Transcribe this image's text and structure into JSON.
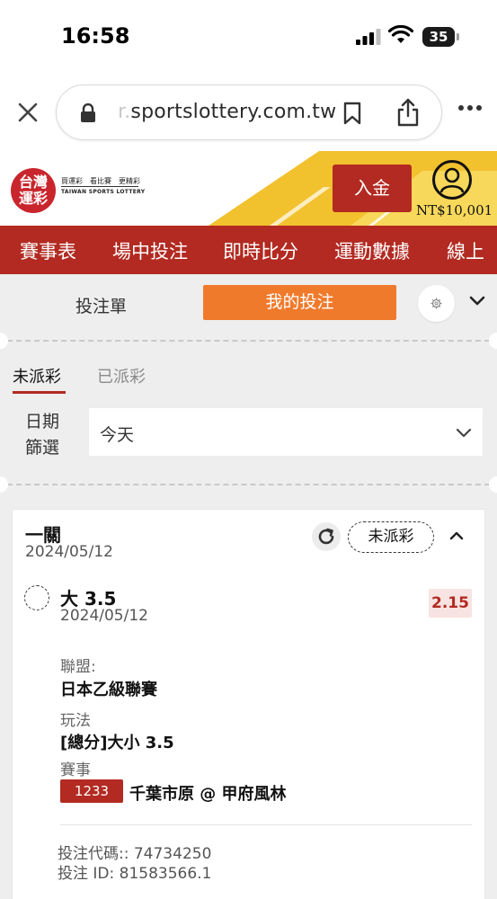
{
  "status_bar": {
    "time": "16:58",
    "battery": "35"
  },
  "browser": {
    "url_prefix": "r.",
    "url_main": "sportslottery.com.tw"
  },
  "header": {
    "logo_mark": "台灣運彩",
    "logo_slogans": "買運彩　看比賽　更精彩",
    "logo_english": "TAIWAN SPORTS LOTTERY",
    "deposit_label": "入金",
    "balance": "NT$10,001",
    "accent_color": "#b22a21",
    "highlight_color": "#f2c12e"
  },
  "nav": {
    "items": [
      "賽事表",
      "場中投注",
      "即時比分",
      "運動數據",
      "線上"
    ]
  },
  "panel": {
    "tabs": {
      "betslip": "投注單",
      "my_bets": "我的投注"
    },
    "subtabs": {
      "unsettled": "未派彩",
      "settled": "已派彩"
    },
    "date_filter": {
      "label_line1": "日期",
      "label_line2": "篩選",
      "value": "今天"
    }
  },
  "bet": {
    "type": "一關",
    "date": "2024/05/12",
    "status": "未派彩",
    "selection": {
      "name": "大 3.5",
      "date": "2024/05/12",
      "odds": "2.15"
    },
    "league_label": "聯盟:",
    "league": "日本乙級聯賽",
    "market_label": "玩法",
    "market": "[總分]大小 3.5",
    "event_label": "賽事",
    "event_id": "1233",
    "event_name": "千葉市原 @ 甲府風林",
    "bet_code": "投注代碼:: 74734250",
    "bet_id": "投注 ID: 81583566.1"
  }
}
